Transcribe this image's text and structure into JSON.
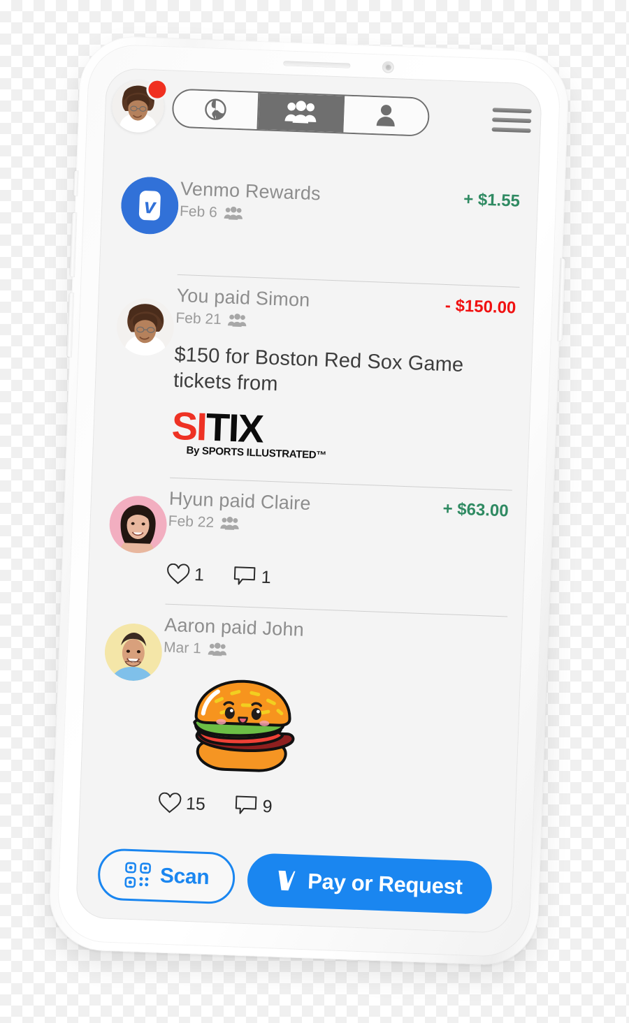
{
  "app": {
    "name": "Venmo",
    "brand_color": "#1a86f0",
    "positive_color": "#2f8a62",
    "negative_color": "#f01111",
    "screen_bg": "#f4f4f4"
  },
  "header": {
    "avatar": {
      "name": "user-avatar",
      "alt": "Profile photo"
    },
    "notification_badge": {
      "visible": true,
      "color": "#f03020"
    },
    "menu_icon": "hamburger-menu-icon",
    "tabs": [
      {
        "id": "public",
        "icon": "globe-icon",
        "label": "Public",
        "active": false
      },
      {
        "id": "friends",
        "icon": "group-people-icon",
        "label": "Friends",
        "active": true
      },
      {
        "id": "private",
        "icon": "single-person-icon",
        "label": "Private",
        "active": false
      }
    ]
  },
  "feed": [
    {
      "id": "venmo-rewards",
      "title": "Venmo Rewards",
      "date": "Feb 6",
      "audience_icon": "group-people-icon",
      "amount": "+ $1.55",
      "amount_sign": "positive",
      "avatar_type": "venmo-logo",
      "note": null,
      "attachment": null,
      "reactions": null
    },
    {
      "id": "you-paid-simon",
      "title": "You paid Simon",
      "date": "Feb 21",
      "audience_icon": "group-people-icon",
      "amount": "- $150.00",
      "amount_sign": "negative",
      "avatar_type": "photo-curly-hair-woman",
      "note": "$150 for Boston Red Sox Game tickets from",
      "attachment": {
        "type": "sitix-logo",
        "primary": "SI",
        "secondary": "TIX",
        "tagline": "By SPORTS ILLUSTRATED™",
        "primary_color": "#ee3224",
        "secondary_color": "#0c0c0c"
      },
      "reactions": null
    },
    {
      "id": "hyun-paid-claire",
      "title": "Hyun paid Claire",
      "date": "Feb 22",
      "audience_icon": "group-people-icon",
      "amount": "+ $63.00",
      "amount_sign": "positive",
      "avatar_type": "photo-woman-pink-bg",
      "note": null,
      "attachment": null,
      "reactions": {
        "likes": "1",
        "comments": "1"
      }
    },
    {
      "id": "aaron-paid-john",
      "title": "Aaron paid John",
      "date": "Mar 1",
      "audience_icon": "group-people-icon",
      "amount": "",
      "amount_sign": "none",
      "avatar_type": "photo-man-yellow-bg",
      "note": null,
      "attachment": {
        "type": "burger-emoji",
        "label": "hamburger emoji"
      },
      "reactions": {
        "likes": "15",
        "comments": "9"
      }
    }
  ],
  "action_bar": {
    "scan": {
      "label": "Scan",
      "icon": "qr-scan-icon"
    },
    "pay": {
      "label": "Pay or Request",
      "icon": "venmo-v-icon"
    }
  }
}
